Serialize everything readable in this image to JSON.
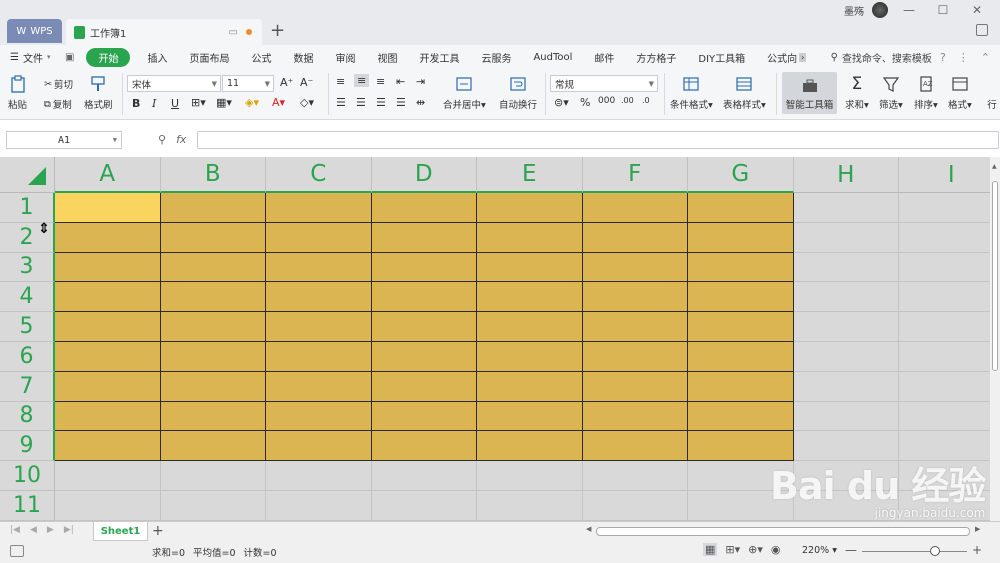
{
  "titlebar": {
    "app_tab": "WPS",
    "doc_tab": "工作簿1",
    "user_name": "墨殇"
  },
  "menubar": {
    "file": "文件",
    "items": [
      "开始",
      "插入",
      "页面布局",
      "公式",
      "数据",
      "审阅",
      "视图",
      "开发工具",
      "云服务",
      "AudTool",
      "邮件",
      "方方格子",
      "DIY工具箱",
      "公式向"
    ],
    "active_index": 0,
    "search": "查找命令、搜索模板"
  },
  "ribbon": {
    "paste": "粘贴",
    "cut": "剪切",
    "copy": "复制",
    "format_painter": "格式刷",
    "font_name": "宋体",
    "font_size": "11",
    "bold": "B",
    "italic": "I",
    "underline": "U",
    "merge_center": "合并居中",
    "wrap_text": "自动换行",
    "number_format": "常规",
    "conditional_format": "条件格式",
    "table_style": "表格样式",
    "smart_toolbox": "智能工具箱",
    "sum": "求和",
    "filter": "筛选",
    "sort": "排序",
    "format": "格式",
    "row_col": "行"
  },
  "formula": {
    "name_box": "A1",
    "fx": "fx",
    "content": ""
  },
  "grid": {
    "columns": [
      "A",
      "B",
      "C",
      "D",
      "E",
      "F",
      "G",
      "H",
      "I"
    ],
    "rows": [
      "1",
      "2",
      "3",
      "4",
      "5",
      "6",
      "7",
      "8",
      "9",
      "10",
      "11"
    ],
    "filled_cols": 7,
    "filled_rows": 9,
    "fill_color": "#dbb552",
    "active_cell_color": "#f9d45f",
    "header_color": "#2aa44f"
  },
  "sheets": {
    "tabs": [
      "Sheet1"
    ]
  },
  "status": {
    "sum": "求和=0",
    "average": "平均值=0",
    "count": "计数=0",
    "zoom": "220%"
  },
  "watermark": {
    "main": "Bai du 经验",
    "sub": "jingyan.baidu.com"
  }
}
